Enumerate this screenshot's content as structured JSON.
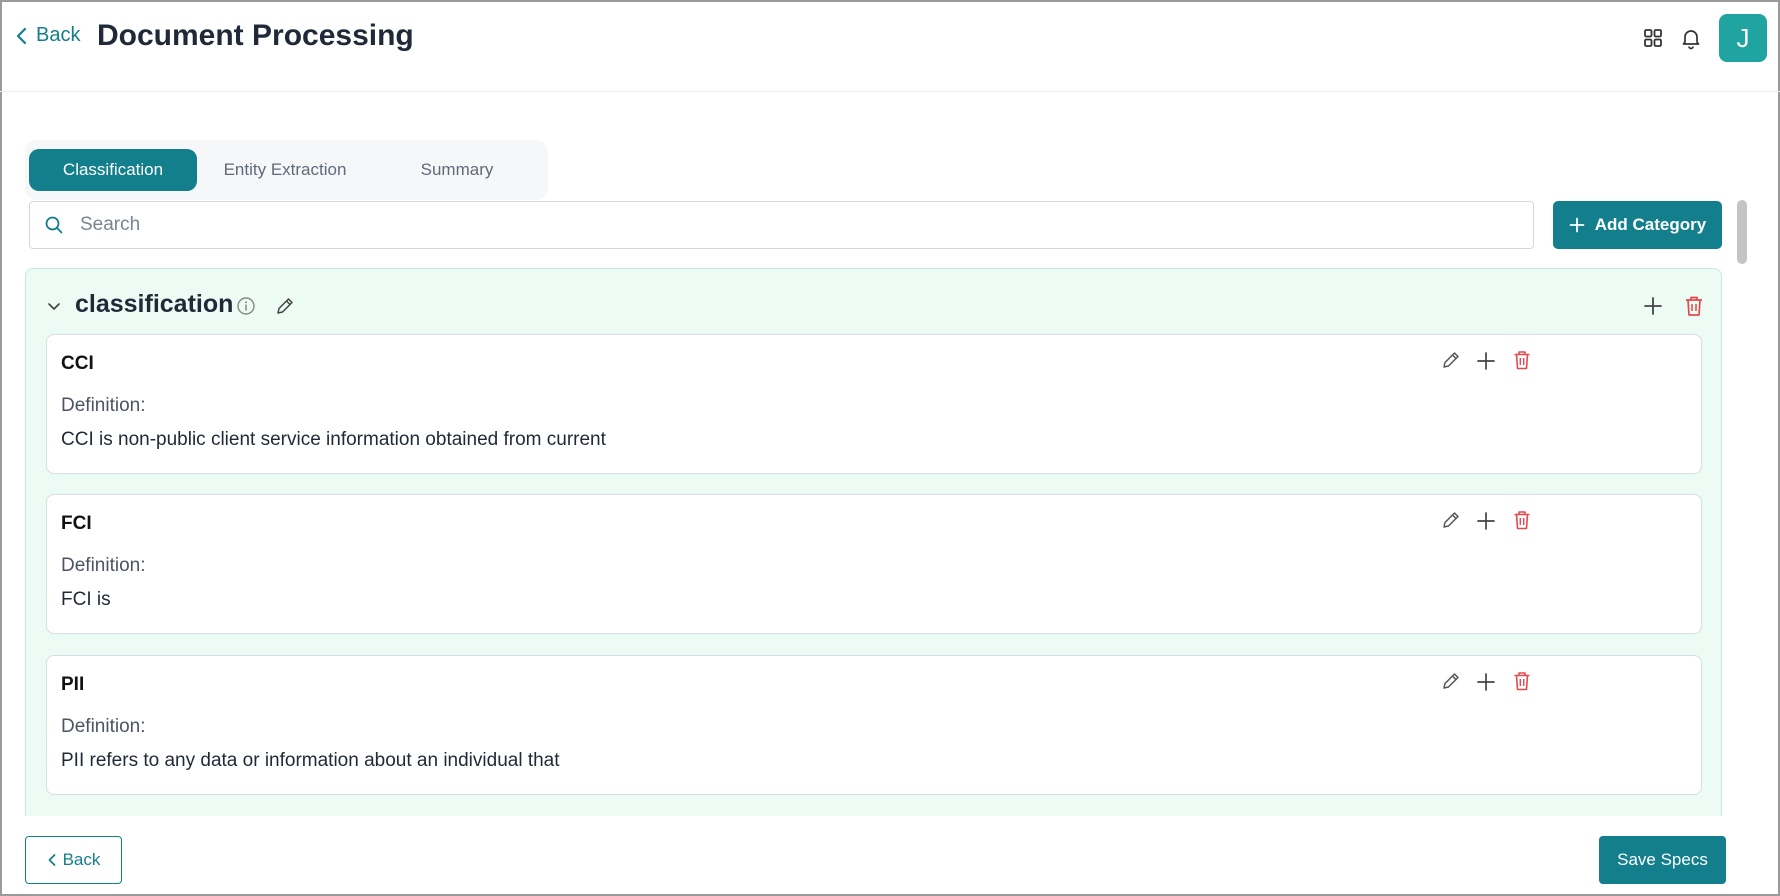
{
  "header": {
    "back_label": "Back",
    "title": "Document Processing",
    "icons": [
      "apps-grid-icon",
      "bell-icon"
    ],
    "avatar_initial": "J"
  },
  "tabs": [
    {
      "label": "Classification",
      "active": true
    },
    {
      "label": "Entity Extraction",
      "active": false
    },
    {
      "label": "Summary",
      "active": false
    }
  ],
  "search": {
    "placeholder": "Search",
    "value": ""
  },
  "add_category_label": "Add Category",
  "category": {
    "title": "classification",
    "expanded": true,
    "items": [
      {
        "name": "CCI",
        "definition_label": "Definition:",
        "definition": "CCI is non-public client service information obtained from current"
      },
      {
        "name": "FCI",
        "definition_label": "Definition:",
        "definition": "FCI is"
      },
      {
        "name": "PII",
        "definition_label": "Definition:",
        "definition": "PII refers to any data or information about an individual that"
      }
    ]
  },
  "footer": {
    "back_label": "Back",
    "save_label": "Save Specs"
  },
  "colors": {
    "primary": "#137f8c",
    "avatar": "#20a4a1",
    "panel_bg": "#ecfbf3",
    "delete": "#e5484d"
  }
}
